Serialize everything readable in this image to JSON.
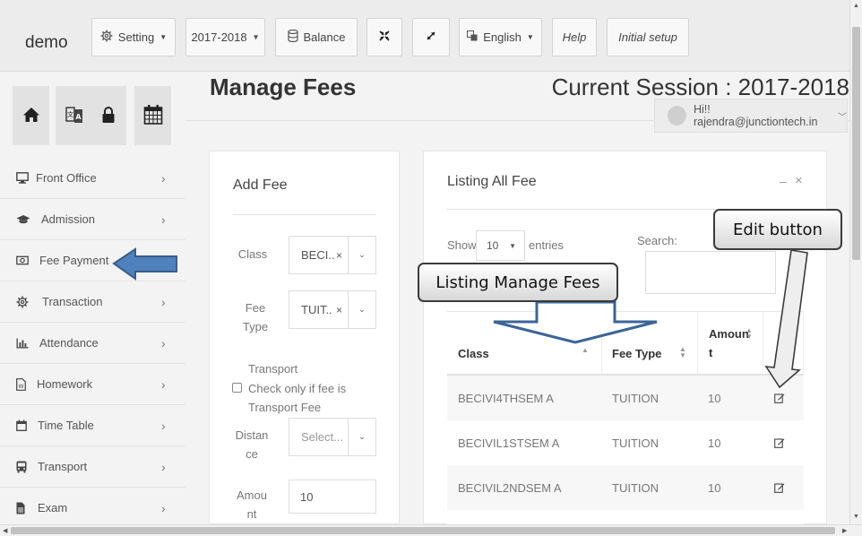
{
  "topbar": {
    "brand": "demo",
    "setting_label": "Setting",
    "session_label": "2017-2018",
    "balance_label": "Balance",
    "language_label": "English",
    "help_label": "Help",
    "initial_setup_label": "Initial setup"
  },
  "header": {
    "page_title": "Manage Fees",
    "current_session": "Current Session : 2017-2018",
    "user_greeting": "Hi!! rajendra@junctiontech.in"
  },
  "sidebar": {
    "quick_icons": [
      "home-icon",
      "language-icon",
      "lock-icon",
      "calendar-icon"
    ],
    "items": [
      {
        "label": "Front Office",
        "icon": "monitor-icon"
      },
      {
        "label": "Admission",
        "icon": "graduation-cap-icon"
      },
      {
        "label": "Fee Payment",
        "icon": "money-icon"
      },
      {
        "label": "Transaction",
        "icon": "gear-icon"
      },
      {
        "label": "Attendance",
        "icon": "bar-chart-icon"
      },
      {
        "label": "Homework",
        "icon": "document-icon"
      },
      {
        "label": "Time Table",
        "icon": "calendar-icon"
      },
      {
        "label": "Transport",
        "icon": "bus-icon"
      },
      {
        "label": "Exam",
        "icon": "file-icon"
      }
    ]
  },
  "add_fee": {
    "title": "Add Fee",
    "class_label": "Class",
    "class_value": "BECI..",
    "fee_type_label_1": "Fee",
    "fee_type_label_2": "Type",
    "fee_type_value": "TUIT..",
    "transport_line1": "Transport",
    "transport_line2": "Check only if fee is",
    "transport_line3": "Transport Fee",
    "distance_label_1": "Distan",
    "distance_label_2": "ce",
    "distance_placeholder": "Select...",
    "amount_label_1": "Amou",
    "amount_label_2": "nt",
    "amount_value": "10",
    "clear_symbol": "×",
    "caret_symbol": "⌄"
  },
  "listing": {
    "title": "Listing All Fee",
    "minimize_symbol": "–",
    "close_symbol": "×",
    "show_label": "Show",
    "entries_value": "10",
    "entries_label": "entries",
    "search_label": "Search:",
    "columns": [
      "Class",
      "Fee Type",
      "Amoun",
      "t"
    ],
    "rows": [
      {
        "class": "BECIVI4THSEM A",
        "fee_type": "TUITION",
        "amount": "10"
      },
      {
        "class": "BECIVIL1STSEM A",
        "fee_type": "TUITION",
        "amount": "10"
      },
      {
        "class": "BECIVIL2NDSEM A",
        "fee_type": "TUITION",
        "amount": "10"
      }
    ]
  },
  "annotations": {
    "edit_button_callout": "Edit button",
    "listing_callout": "Listing Manage Fees"
  },
  "colors": {
    "arrow_blue": "#4f81bd",
    "arrow_blue_dark": "#385d8a",
    "callout_border": "#3b3b3b"
  }
}
